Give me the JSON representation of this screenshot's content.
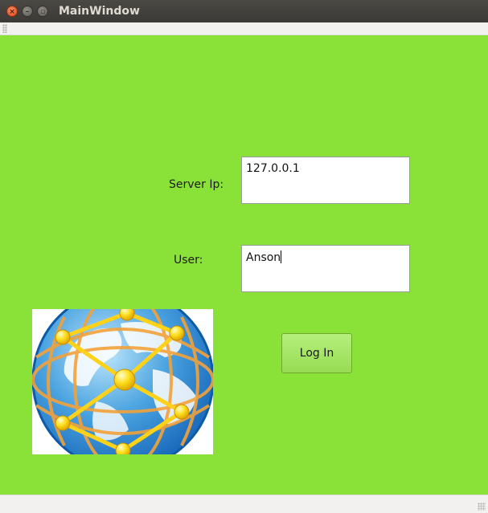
{
  "window": {
    "title": "MainWindow",
    "close_glyph": "×",
    "minimize_glyph": "–",
    "maximize_glyph": "▫"
  },
  "form": {
    "server_ip_label": "Server Ip:",
    "server_ip_value": "127.0.0.1",
    "user_label": "User:",
    "user_value": "Anson",
    "login_button": "Log In"
  },
  "colors": {
    "background": "#8ae238",
    "button": "#a6e466",
    "titlebar": "#3f3e3a"
  },
  "icons": {
    "logo": "globe-network-icon"
  }
}
